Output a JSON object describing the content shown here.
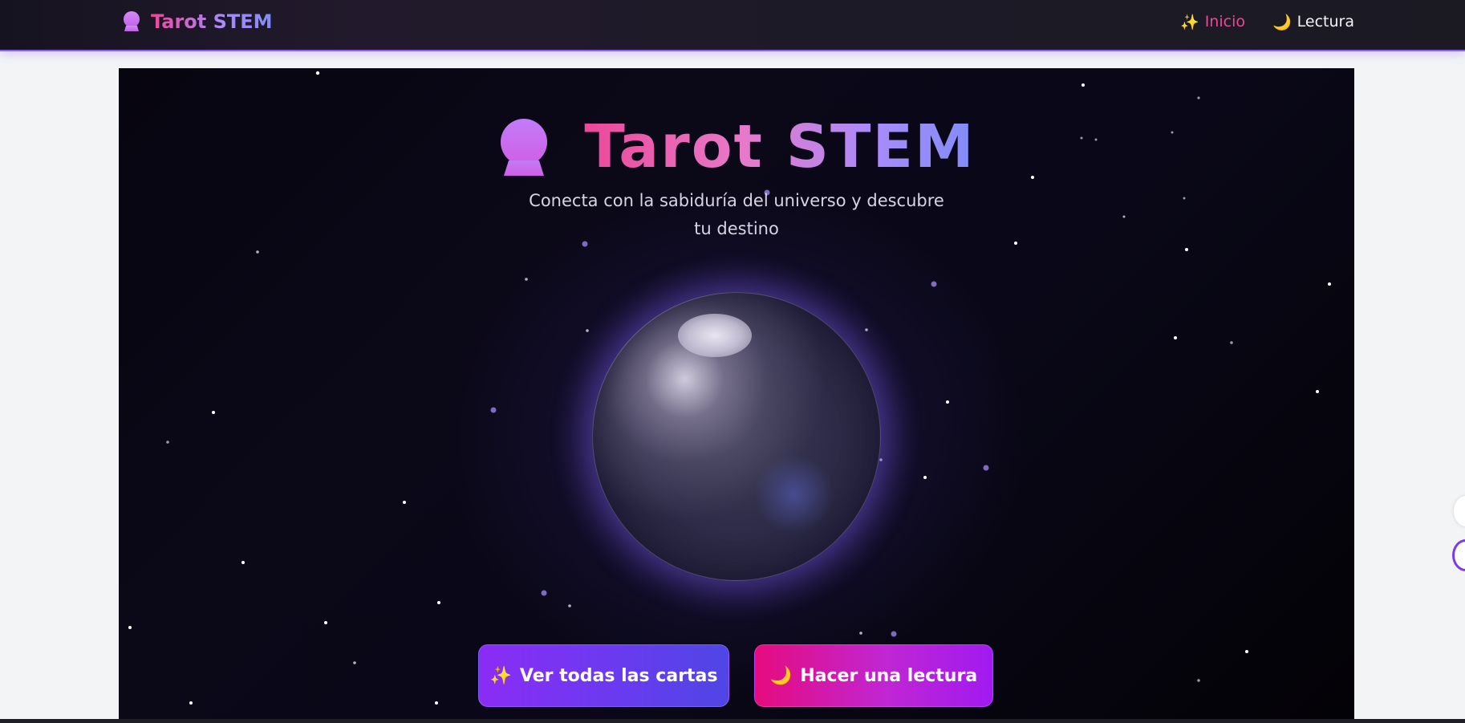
{
  "navbar": {
    "brand": {
      "icon": "crystal-ball-icon",
      "title": "Tarot STEM"
    },
    "links": [
      {
        "icon": "sparkles-icon",
        "emoji": "✨",
        "label": "Inicio",
        "active": true
      },
      {
        "icon": "crescent-moon-icon",
        "emoji": "🌙",
        "label": "Lectura",
        "active": false
      }
    ]
  },
  "hero": {
    "icon": "crystal-ball-icon",
    "title": "Tarot STEM",
    "subtitle": "Conecta con la sabiduría del universo y descubre tu destino",
    "buttons": [
      {
        "icon": "sparkles-icon",
        "emoji": "✨",
        "label": "Ver todas las cartas"
      },
      {
        "icon": "crescent-moon-icon",
        "emoji": "🌙",
        "label": "Hacer una lectura"
      }
    ]
  },
  "colors": {
    "accent_pink": "#ec4899",
    "accent_purple": "#8b5cf6",
    "accent_indigo": "#818cf8",
    "hero_bg": "#0b0818",
    "nav_bg": "#1c1a26"
  }
}
